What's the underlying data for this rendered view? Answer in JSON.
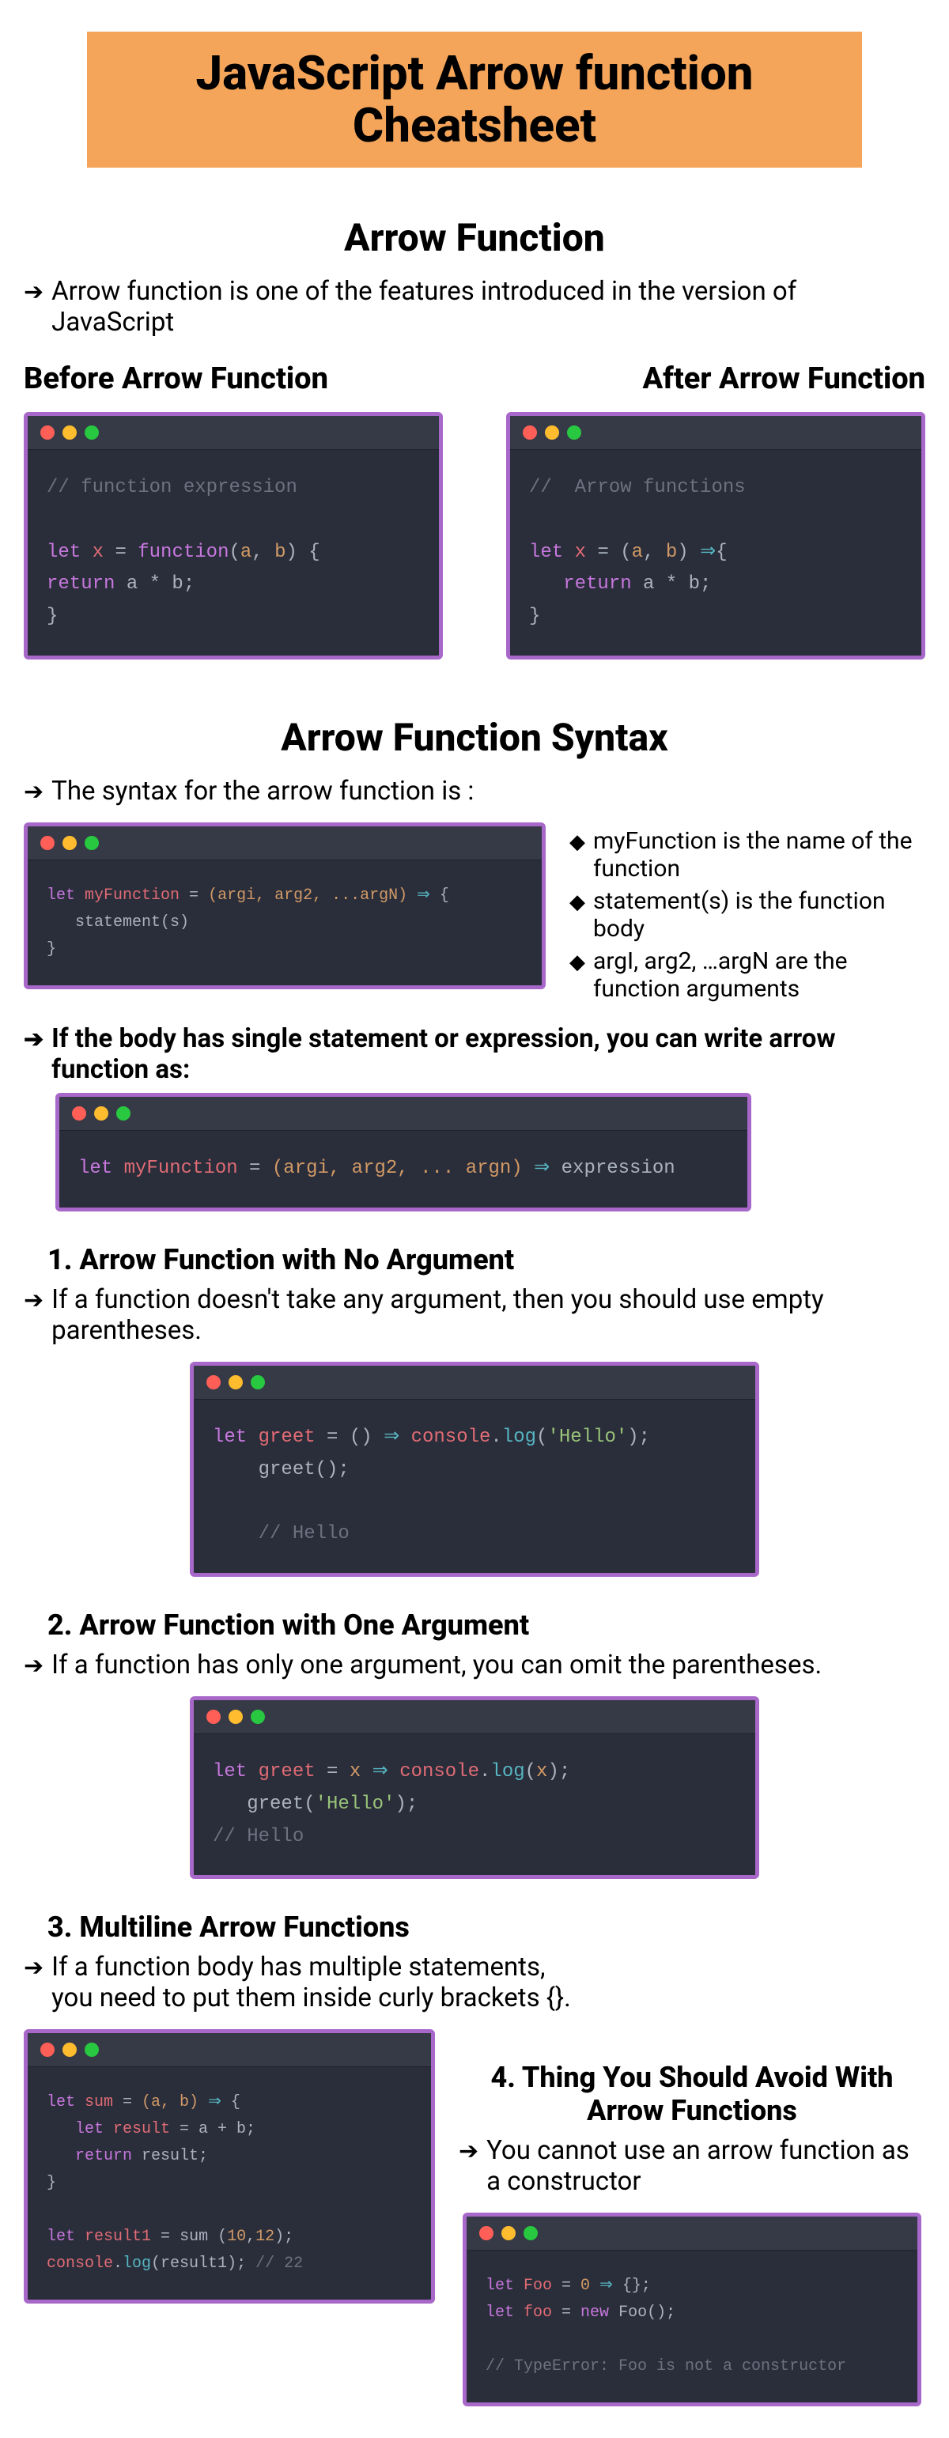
{
  "title": "JavaScript Arrow function Cheatsheet",
  "section1": {
    "heading": "Arrow Function",
    "intro": "Arrow function is one of the features introduced in  the version of JavaScript",
    "before_label": "Before Arrow Function",
    "after_label": "After Arrow Function",
    "code_before": {
      "comment": "// function expression",
      "line1_let": "let",
      "line1_x": " x ",
      "line1_eq": "= ",
      "line1_fn": "function",
      "line1_paren": "(",
      "line1_a": "a",
      "line1_comma": ", ",
      "line1_b": "b",
      "line1_close": ") {",
      "line2_ret": "return",
      "line2_body": " a * b;",
      "line3": "}"
    },
    "code_after": {
      "comment": "//  Arrow functions",
      "line1_let": "let",
      "line1_x": " x ",
      "line1_eq": "= ",
      "line1_paren": "(",
      "line1_a": "a",
      "line1_comma": ", ",
      "line1_b": "b",
      "line1_close": ") ",
      "line1_arrow": "⇒",
      "line1_brace": "{",
      "line2_ret": "   return",
      "line2_body": " a * b;",
      "line3": "}"
    }
  },
  "section2": {
    "heading": "Arrow Function Syntax",
    "intro": "The syntax for the arrow function is :",
    "bullets": {
      "b1": "myFunction is the name of the function",
      "b2": "statement(s) is the function body",
      "b3": "argI, arg2, …argN are the function arguments"
    },
    "code_syntax": {
      "let": "let",
      "name": " myFunction ",
      "eq": "= ",
      "args": "(argi, arg2, ...argN)",
      "arrow": " ⇒ ",
      "brace": "{",
      "body": "   statement(s)",
      "close": "}"
    },
    "single_line_text": "If the body has single statement or expression, you can write arrow function as:",
    "code_single": {
      "let": "let",
      "name": " myFunction ",
      "eq": "= ",
      "args": "(argi, arg2, ... argn)",
      "arrow": " ⇒ ",
      "expr": "expression"
    }
  },
  "sub1": {
    "heading": "1. Arrow Function with No Argument",
    "text": "If a function doesn't take any argument, then you should use empty parentheses.",
    "code": {
      "let": "let",
      "name": " greet ",
      "eq": "= ",
      "parens": "()",
      "arrow": " ⇒ ",
      "console": "console",
      "dot": ".",
      "log": "log",
      "open": "(",
      "str": "'Hello'",
      "close": ");",
      "call": "    greet();",
      "comment": "    // Hello"
    }
  },
  "sub2": {
    "heading": "2. Arrow Function with One Argument",
    "text": "If a function has only one argument, you can omit the parentheses.",
    "code": {
      "let": "let",
      "name": " greet ",
      "eq": "= ",
      "x": "x",
      "arrow": " ⇒ ",
      "console": "console",
      "dot": ".",
      "log": "log",
      "open": "(",
      "xarg": "x",
      "close": ");",
      "call_pre": "   greet(",
      "call_str": "'Hello'",
      "call_post": ");",
      "comment": "// Hello"
    }
  },
  "sub3": {
    "heading": "3. Multiline Arrow Functions",
    "text": "If a function body has multiple statements, you need to put them inside curly brackets {}.",
    "code": {
      "let1": "let",
      "sum": " sum ",
      "eq": "= ",
      "args": "(a, b)",
      "arrow": " ⇒ ",
      "brace": "{",
      "let2": "   let",
      "res": " result ",
      "eq2": "= ",
      "expr": "a + b;",
      "ret": "   return",
      "retv": " result;",
      "close": "}",
      "let3": "let",
      "r1": " result1 ",
      "eq3": "= ",
      "call": "sum (",
      "n1": "10",
      "c": ",",
      "n2": "12",
      "cp": ");",
      "console": "console",
      "dot": ".",
      "log": "log",
      "lo": "(result1); ",
      "comment": "// 22"
    }
  },
  "sub4": {
    "heading": "4. Thing You Should Avoid With Arrow Functions",
    "text": "You cannot use an arrow function as a constructor",
    "code": {
      "let1": "let",
      "foo1": " Foo ",
      "eq1": "= ",
      "zero": "0",
      "arrow": " ⇒ ",
      "body": "{};",
      "let2": "let",
      "foo2": " foo ",
      "eq2": "= ",
      "new": "new",
      "call": " Foo();",
      "comment": "// TypeError: Foo is not a constructor"
    }
  }
}
